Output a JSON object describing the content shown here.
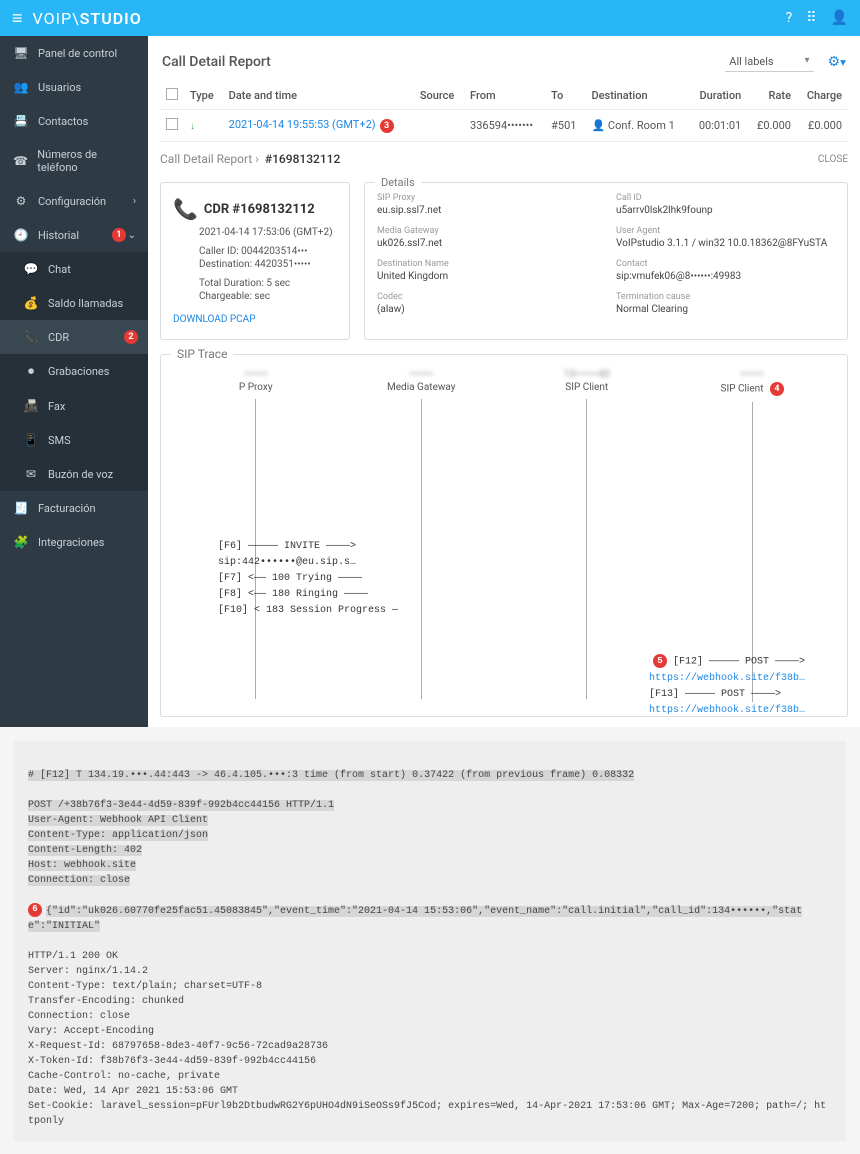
{
  "logo": {
    "part1": "VOIP",
    "part2": "STUDIO"
  },
  "sidebar": {
    "items": [
      {
        "icon": "🖥",
        "label": "Panel de control"
      },
      {
        "icon": "👥",
        "label": "Usuarios"
      },
      {
        "icon": "📇",
        "label": "Contactos"
      },
      {
        "icon": "☎",
        "label": "Números de teléfono"
      },
      {
        "icon": "⚙",
        "label": "Configuración",
        "chevron": "›"
      },
      {
        "icon": "🕘",
        "label": "Historial",
        "chevron": "⌄",
        "badge": "1"
      },
      {
        "icon": "💬",
        "label": "Chat",
        "sub": true
      },
      {
        "icon": "💰",
        "label": "Saldo llamadas",
        "sub": true
      },
      {
        "icon": "📞",
        "label": "CDR",
        "sub": true,
        "active": true,
        "badge": "2"
      },
      {
        "icon": "⏺",
        "label": "Grabaciones",
        "sub": true
      },
      {
        "icon": "📠",
        "label": "Fax",
        "sub": true
      },
      {
        "icon": "📱",
        "label": "SMS",
        "sub": true
      },
      {
        "icon": "✉",
        "label": "Buzón de voz",
        "sub": true
      },
      {
        "icon": "🧾",
        "label": "Facturación"
      },
      {
        "icon": "🧩",
        "label": "Integraciones"
      }
    ]
  },
  "report": {
    "title": "Call Detail Report",
    "labels_dropdown": "All labels",
    "columns": [
      "Type",
      "Date and time",
      "Source",
      "From",
      "To",
      "Destination",
      "Duration",
      "Rate",
      "Charge"
    ],
    "row": {
      "datetime": "2021-04-14 19:55:53 (GMT+2)",
      "datetime_badge": "3",
      "source": "",
      "from": "336594•••••••",
      "to": "#501",
      "destination": "Conf. Room 1",
      "duration": "00:01:01",
      "rate": "£0.000",
      "charge": "£0.000"
    }
  },
  "breadcrumb": {
    "root": "Call Detail Report",
    "sep": "›",
    "current": "#1698132112",
    "close": "CLOSE"
  },
  "cdr": {
    "title": "CDR #1698132112",
    "ts": "2021-04-14 17:53:06 (GMT+2)",
    "caller_id": "Caller ID: 0044203514•••",
    "destination": "Destination: 4420351•••••",
    "total_duration": "Total Duration: 5 sec",
    "chargeable": "Chargeable: sec",
    "download": "DOWNLOAD PCAP"
  },
  "details": {
    "legend": "Details",
    "sip_proxy_lab": "SIP Proxy",
    "sip_proxy_val": "eu.sip.ssl7.net",
    "call_id_lab": "Call ID",
    "call_id_val": "u5arrv0lsk2lhk9founp",
    "media_gw_lab": "Media Gateway",
    "media_gw_val": "uk026.ssl7.net",
    "user_agent_lab": "User Agent",
    "user_agent_val": "VoIPstudio 3.1.1 / win32 10.0.18362@8FYuSTA",
    "dest_name_lab": "Destination Name",
    "dest_name_val": "United Kingdom",
    "contact_lab": "Contact",
    "contact_val": "sip:vmufek06@8••••••:49983",
    "codec_lab": "Codec",
    "codec_val": "(alaw)",
    "term_lab": "Termination cause",
    "term_val": "Normal Clearing"
  },
  "sip": {
    "legend": "SIP Trace",
    "cols": [
      {
        "ip": "•••••••",
        "name": "P Proxy"
      },
      {
        "ip": "•••••••",
        "name": "Media Gateway"
      },
      {
        "ip": "13•••••••43",
        "name": "SIP Client"
      },
      {
        "ip": "•••••••",
        "name": "SIP Client",
        "badge": "4"
      }
    ],
    "msgs": [
      "[F6] ————— INVITE ————>",
      "   sip:442••••••@eu.sip.s…",
      "[F7] <—— 100 Trying ————",
      "[F8] <—— 180 Ringing ————",
      "[F10] < 183 Session Progress —"
    ],
    "msgs2": [
      {
        "badge": "5",
        "line": "[F12] ————— POST ————>",
        "url": "https://webhook.site/f38b…"
      },
      {
        "line": "[F13] ————— POST ————>",
        "url": "https://webhook.site/f38b…"
      }
    ]
  },
  "http": {
    "header_line": "# [F12] T 134.19.•••.44:443 -> 46.4.105.•••:3 time (from start) 0.37422 (from previous frame) 0.08332",
    "request": "POST /+38b76f3-3e44-4d59-839f-992b4cc44156 HTTP/1.1\nUser-Agent: Webhook API Client\nContent-Type: application/json\nContent-Length: 402\nHost: webhook.site\nConnection: close",
    "badge": "6",
    "json_body": "{\"id\":\"uk026.60770fe25fac51.45083845\",\"event_time\":\"2021-04-14 15:53:06\",\"event_name\":\"call.initial\",\"call_id\":134••••••,\"state\":\"INITIAL\"",
    "response": "HTTP/1.1 200 OK\nServer: nginx/1.14.2\nContent-Type: text/plain; charset=UTF-8\nTransfer-Encoding: chunked\nConnection: close\nVary: Accept-Encoding\nX-Request-Id: 68797658-8de3-40f7-9c56-72cad9a28736\nX-Token-Id: f38b76f3-3e44-4d59-839f-992b4cc44156\nCache-Control: no-cache, private\nDate: Wed, 14 Apr 2021 15:53:06 GMT\nSet-Cookie: laravel_session=pFUrl9b2DtbudwRG2Y6pUHO4dN9iSeOSs9fJ5Cod; expires=Wed, 14-Apr-2021 17:53:06 GMT; Max-Age=7200; path=/; httponly"
  }
}
